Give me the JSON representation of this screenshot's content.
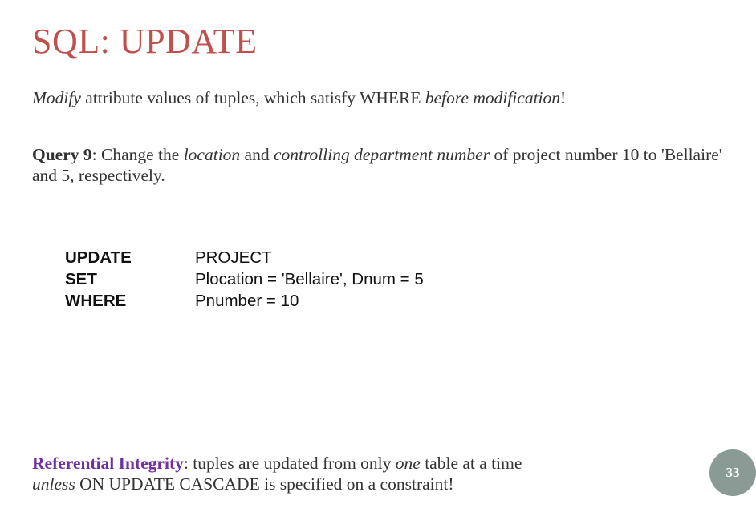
{
  "title": "SQL: UPDATE",
  "p1": {
    "modify": "Modify",
    "mid": " attribute values of tuples, which satisfy WHERE ",
    "before": "before modification",
    "end": "!"
  },
  "p2": {
    "query": "Query 9",
    "a": ": Change the ",
    "location": "location",
    "b": " and ",
    "controlling": "controlling department number",
    "c": " of project number 10 to 'Bellaire' and 5, respectively."
  },
  "code": [
    {
      "kw": "UPDATE",
      "val": "PROJECT"
    },
    {
      "kw": "SET",
      "val": "Plocation = 'Bellaire', Dnum = 5"
    },
    {
      "kw": "WHERE",
      "val": "Pnumber = 10"
    }
  ],
  "p3": {
    "ref": "Referential Integrity",
    "a": ": tuples are updated from only ",
    "one": "one",
    "b": " table at a time",
    "unless": "unless",
    "c": " ON UPDATE CASCADE is specified on a constraint!"
  },
  "page_number": "33"
}
